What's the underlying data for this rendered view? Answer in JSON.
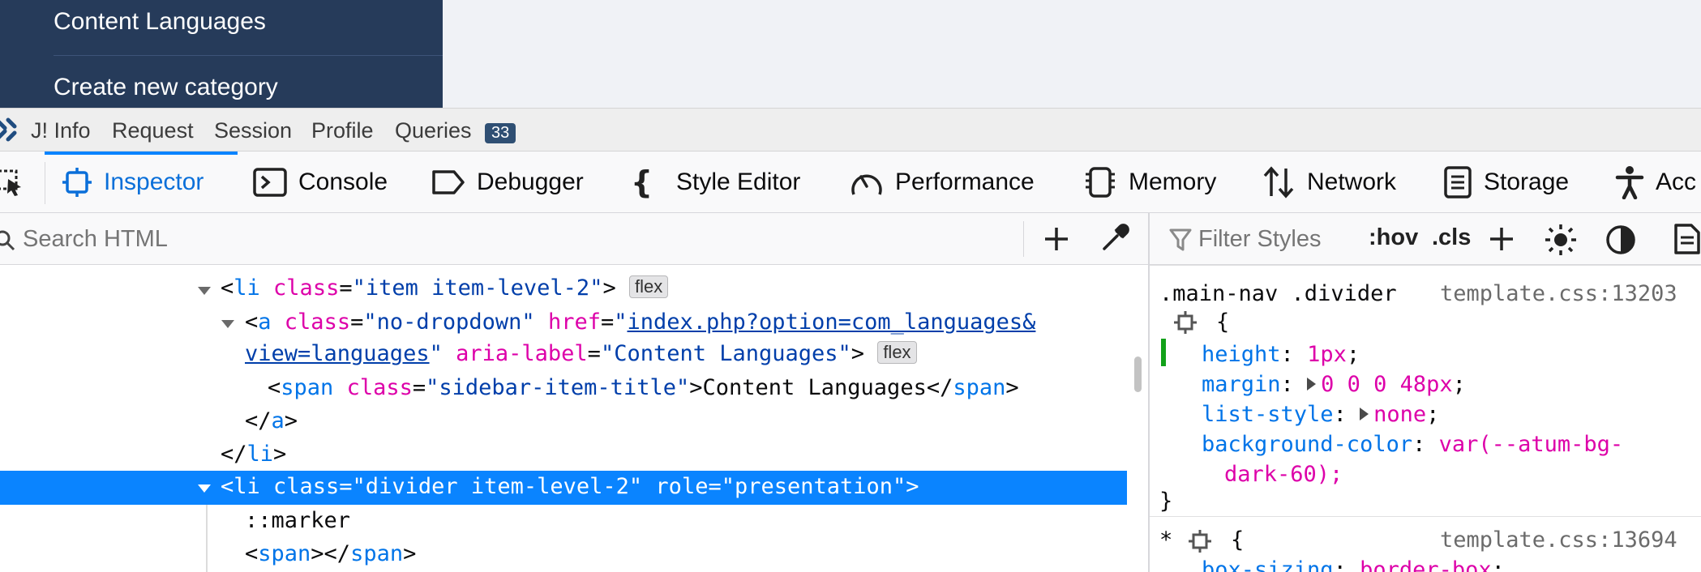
{
  "sidebar": {
    "items": [
      {
        "label": "Content Languages"
      },
      {
        "label": "Create new category"
      }
    ]
  },
  "debugbar": {
    "items": [
      "J! Info",
      "Request",
      "Session",
      "Profile",
      "Queries"
    ],
    "queries_count": "33"
  },
  "devtools": {
    "tabs": [
      {
        "label": "Inspector",
        "icon": "inspector-icon",
        "selected": true
      },
      {
        "label": "Console",
        "icon": "console-icon"
      },
      {
        "label": "Debugger",
        "icon": "debugger-icon"
      },
      {
        "label": "Style Editor",
        "icon": "style-editor-icon"
      },
      {
        "label": "Performance",
        "icon": "performance-icon"
      },
      {
        "label": "Memory",
        "icon": "memory-icon"
      },
      {
        "label": "Network",
        "icon": "network-icon"
      },
      {
        "label": "Storage",
        "icon": "storage-icon"
      },
      {
        "label": "Acc",
        "icon": "accessibility-icon"
      }
    ],
    "accent_color": "#0a84ff"
  },
  "html_toolbar": {
    "search_placeholder": "Search HTML"
  },
  "rules_toolbar": {
    "filter_placeholder": "Filter Styles",
    "hov": ":hov",
    "cls": ".cls"
  },
  "markup": {
    "line1": {
      "tag_open": "<",
      "tag": "li",
      "a1": "class",
      "v1": "\"item item-level-2\"",
      "close": ">",
      "badge": "flex"
    },
    "line2": {
      "tag": "a",
      "a1": "class",
      "v1": "\"no-dropdown\"",
      "a2": "href",
      "q": "\"",
      "href1": "index.php?option=com_languages&",
      "badge": "flex"
    },
    "line3": {
      "href2": "view=languages",
      "q": "\"",
      "a3": "aria-label",
      "v3": "\"Content Languages\""
    },
    "line4": {
      "tag": "span",
      "a1": "class",
      "v1": "\"sidebar-item-title\"",
      "text": "Content Languages"
    },
    "line5": {
      "tag": "a"
    },
    "line6": {
      "tag": "li"
    },
    "line7": {
      "text": "<li class=\"divider item-level-2\" role=\"presentation\">"
    },
    "line8": {
      "text": "::marker"
    },
    "line9": {
      "tag": "span"
    }
  },
  "rules": {
    "rule1": {
      "selector": ".main-nav .divider",
      "source": "template.css:13203",
      "declarations": [
        {
          "prop": "height",
          "value": "1px"
        },
        {
          "prop": "margin",
          "value": "0 0 0 48px"
        },
        {
          "prop": "list-style",
          "value": "none"
        },
        {
          "prop": "background-color",
          "value": "var(--atum-bg-",
          "value_cont": "dark-60);"
        }
      ]
    },
    "rule2": {
      "selector": "*",
      "source": "template.css:13694",
      "partial_prop": "box-sizing",
      "partial_value": "border-box"
    }
  }
}
